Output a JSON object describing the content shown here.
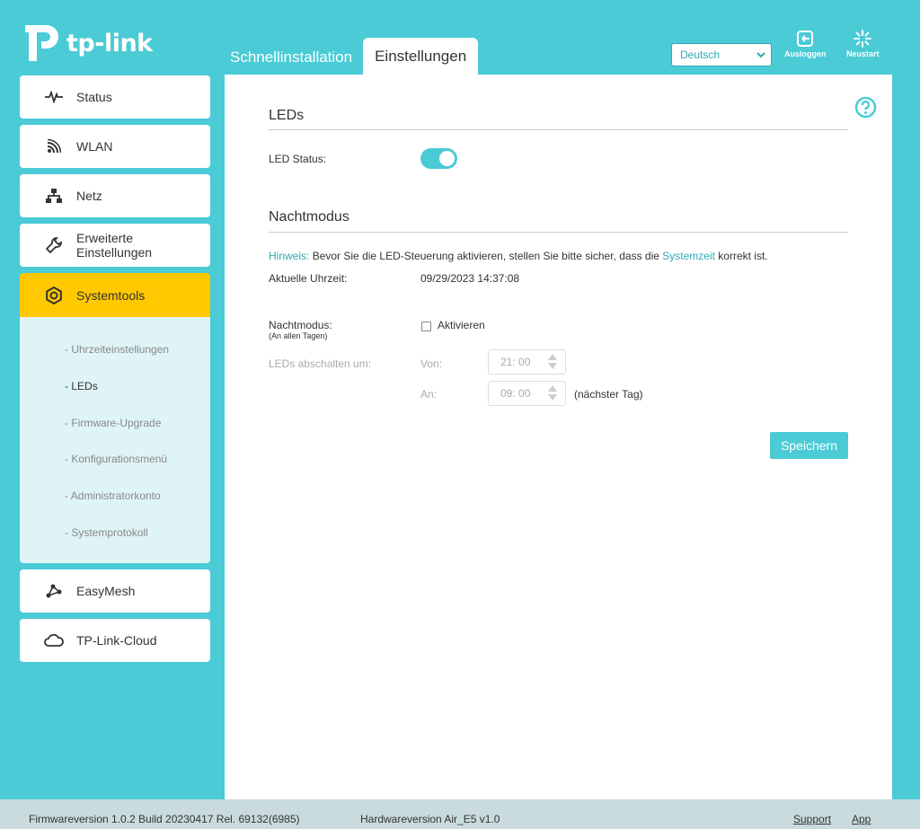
{
  "header": {
    "logo_text": "tp-link",
    "tabs": [
      {
        "label": "Schnellinstallation",
        "active": false
      },
      {
        "label": "Einstellungen",
        "active": true
      }
    ],
    "language": "Deutsch",
    "logout_label": "Ausloggen",
    "restart_label": "Neustart"
  },
  "sidebar": {
    "items": [
      {
        "label": "Status",
        "icon": "pulse-icon"
      },
      {
        "label": "WLAN",
        "icon": "wifi-icon"
      },
      {
        "label": "Netz",
        "icon": "network-icon"
      },
      {
        "label": "Erweiterte Einstellungen",
        "line1": "Erweiterte",
        "line2": "Einstellungen",
        "icon": "wrench-icon"
      },
      {
        "label": "Systemtools",
        "icon": "gear-icon",
        "active": true
      },
      {
        "label": "EasyMesh",
        "icon": "mesh-icon"
      },
      {
        "label": "TP-Link-Cloud",
        "icon": "cloud-icon"
      }
    ],
    "submenu": [
      {
        "label": "Uhrzeiteinstellungen",
        "active": false
      },
      {
        "label": "LEDs",
        "active": true
      },
      {
        "label": "Firmware-Upgrade",
        "active": false
      },
      {
        "label": "Konfigurationsmenü",
        "active": false
      },
      {
        "label": "Administratorkonto",
        "active": false
      },
      {
        "label": "Systemprotokoll",
        "active": false
      }
    ]
  },
  "main": {
    "leds_title": "LEDs",
    "led_status_label": "LED Status:",
    "led_status_on": true,
    "night_title": "Nachtmodus",
    "hint_label": "Hinweis:",
    "hint_text_1": "Bevor Sie die LED-Steuerung aktivieren, stellen Sie bitte sicher, dass die",
    "hint_link": "Systemzeit",
    "hint_text_2": "korrekt ist.",
    "current_time_label": "Aktuelle Uhrzeit:",
    "current_time_value": "09/29/2023 14:37:08",
    "night_mode_label": "Nachtmodus:",
    "night_mode_sub": "(An allen Tagen)",
    "enable_label": "Aktivieren",
    "enable_checked": false,
    "leds_off_label": "LEDs abschalten um:",
    "from_label": "Von:",
    "from_value": "21: 00",
    "to_label": "An:",
    "to_value": "09: 00",
    "next_day": "(nächster Tag)",
    "save_label": "Speichern"
  },
  "footer": {
    "firmware": "Firmwareversion 1.0.2 Build 20230417 Rel. 69132(6985)",
    "hardware": "Hardwareversion Air_E5 v1.0",
    "support": "Support",
    "app": "App"
  },
  "colors": {
    "accent": "#4acbd6",
    "active_nav": "#ffc800",
    "submenu_bg": "#dff4f6",
    "footer_bg": "#c9dbdd"
  }
}
